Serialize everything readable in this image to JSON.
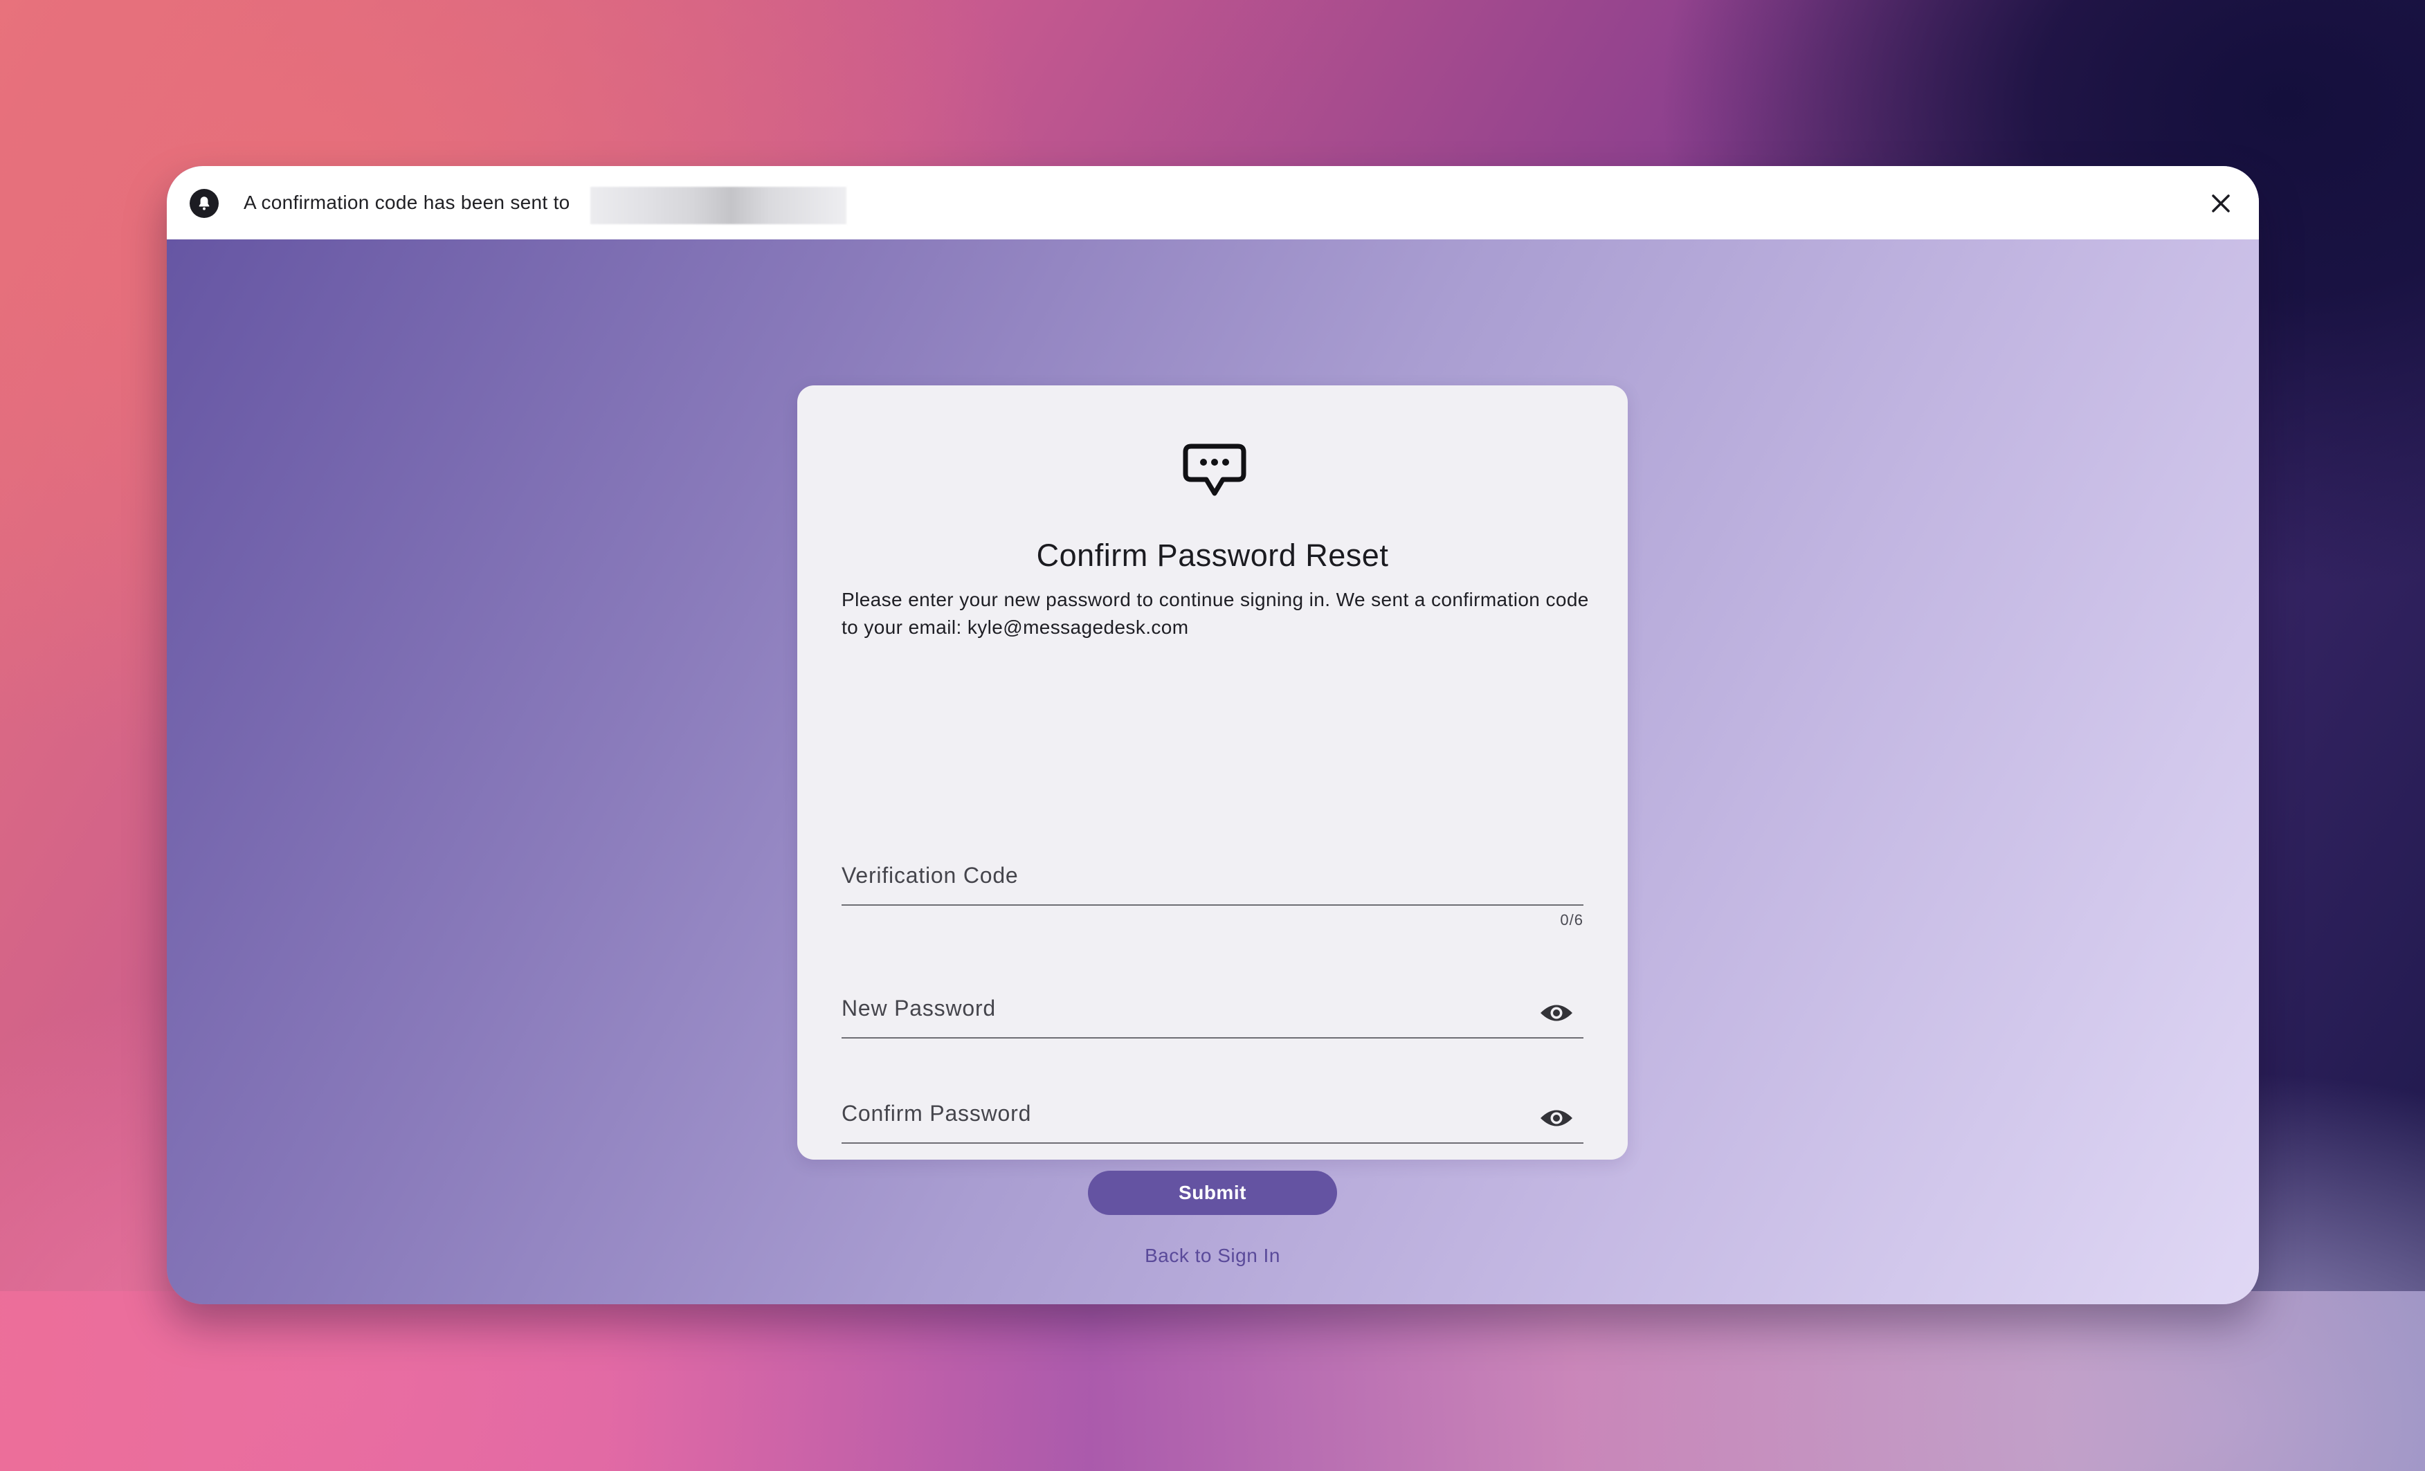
{
  "notification": {
    "message": "A confirmation code has been sent to",
    "icon": "bell-icon",
    "close_icon": "close-icon"
  },
  "card": {
    "logo_icon": "chat-bubble-icon",
    "title": "Confirm Password Reset",
    "description": "Please enter your new password to continue signing in. We sent a confirmation code to your email: kyle@messagedesk.com",
    "fields": [
      {
        "label": "Verification Code",
        "value": "",
        "counter": "0/6"
      },
      {
        "label": "New Password",
        "value": "",
        "icon": "eye-icon"
      },
      {
        "label": "Confirm Password",
        "value": "",
        "icon": "eye-icon"
      }
    ],
    "submit_label": "Submit",
    "back_label": "Back to Sign In"
  },
  "colors": {
    "accent": "#6453a2",
    "card_bg": "#f1f0f4",
    "link": "#5a4a9a"
  }
}
